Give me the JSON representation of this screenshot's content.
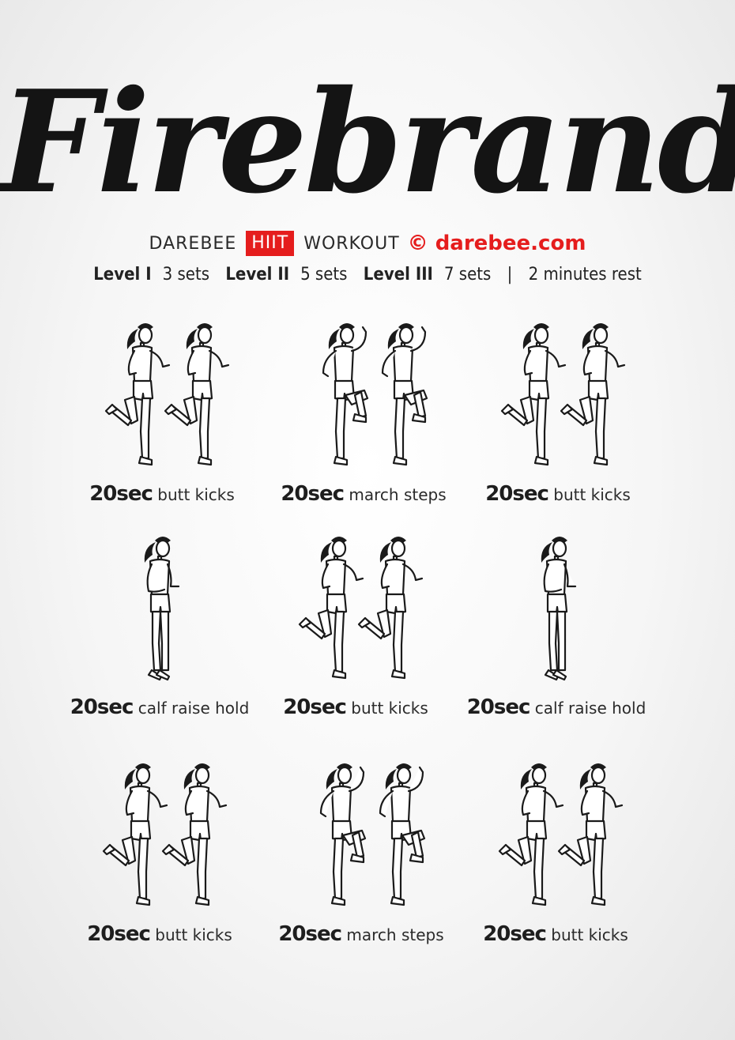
{
  "title": "Firebrand",
  "brand": {
    "left": "DAREBEE",
    "badge": "HIIT",
    "right": "WORKOUT",
    "copyright": "© darebee.com",
    "badge_color": "#e51d1d"
  },
  "levels": [
    {
      "name": "Level I",
      "sets": "3 sets"
    },
    {
      "name": "Level II",
      "sets": "5 sets"
    },
    {
      "name": "Level III",
      "sets": "7 sets"
    }
  ],
  "separator": "|",
  "rest": "2 minutes rest",
  "exercises": [
    {
      "duration": "20sec",
      "name": "butt kicks",
      "pose": "butt-kicks"
    },
    {
      "duration": "20sec",
      "name": "march steps",
      "pose": "march-steps"
    },
    {
      "duration": "20sec",
      "name": "butt kicks",
      "pose": "butt-kicks"
    },
    {
      "duration": "20sec",
      "name": "calf raise hold",
      "pose": "calf-raise"
    },
    {
      "duration": "20sec",
      "name": "butt kicks",
      "pose": "butt-kicks"
    },
    {
      "duration": "20sec",
      "name": "calf raise hold",
      "pose": "calf-raise"
    },
    {
      "duration": "20sec",
      "name": "butt kicks",
      "pose": "butt-kicks"
    },
    {
      "duration": "20sec",
      "name": "march steps",
      "pose": "march-steps"
    },
    {
      "duration": "20sec",
      "name": "butt kicks",
      "pose": "butt-kicks"
    }
  ]
}
